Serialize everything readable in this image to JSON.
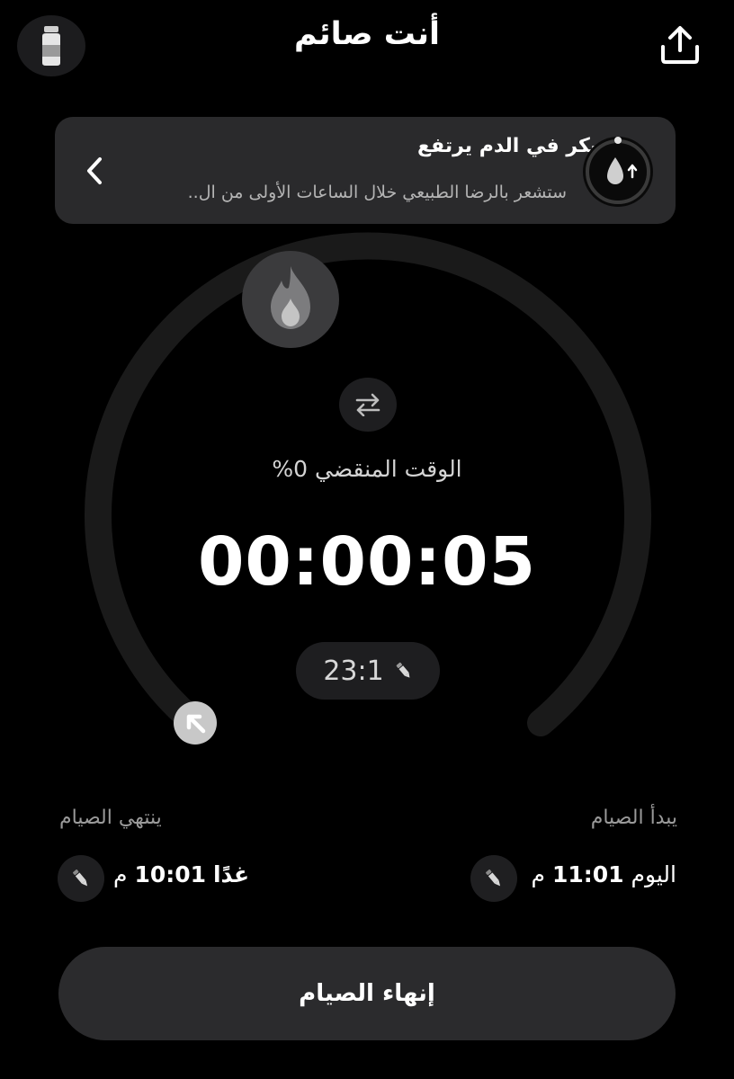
{
  "header": {
    "title": "أنت صائم",
    "left_icon": "bottle-icon",
    "right_icon": "share-icon"
  },
  "banner": {
    "title": "السكر في الدم يرتفع",
    "subtitle": "ستشعر بالرضا الطبيعي خلال الساعات الأولى من ال..",
    "icon": "blood-drop-up-icon",
    "chevron_icon": "chevron-left-icon"
  },
  "timer": {
    "elapsed_label": "الوقت المنقضي 0%",
    "elapsed_percent": 0,
    "value": "00:00:05",
    "plan": "23:1",
    "flame_icon": "flame-icon",
    "swap_icon": "swap-arrows-icon",
    "marker_icon": "arrow-up-left-icon"
  },
  "schedule": {
    "start_label": "يبدأ الصيام",
    "start_day": "اليوم",
    "start_time": "11:01",
    "start_ampm": "م",
    "end_label": "ينتهي الصيام",
    "end_day": "غدًا",
    "end_time": "10:01",
    "end_ampm": "م",
    "edit_icon": "pencil-icon"
  },
  "actions": {
    "end_fast": "إنهاء الصيام"
  },
  "colors": {
    "background": "#000000",
    "card": "#2a2a2c",
    "ring_track": "#1a1a1a",
    "accent_gray": "#3b3b3d"
  }
}
